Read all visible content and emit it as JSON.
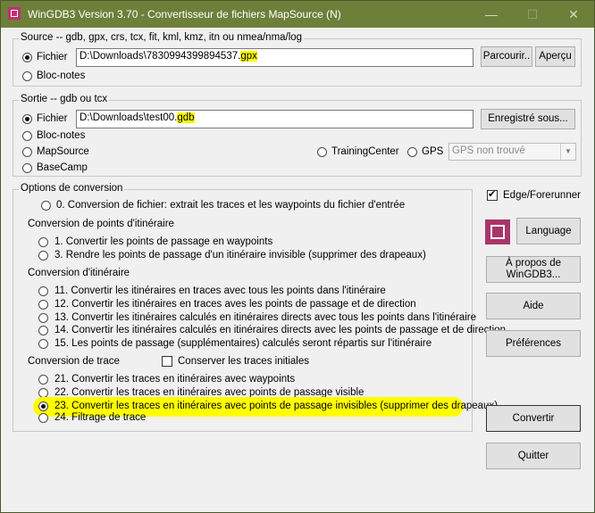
{
  "window": {
    "title": "WinGDB3 Version 3.70 - Convertisseur de fichiers MapSource (N)"
  },
  "source": {
    "legend": "Source -- gdb, gpx, crs, tcx, fit, kml, kmz, itn ou nmea/nma/log",
    "fichier_label": "Fichier",
    "path_prefix": "D:\\Downloads\\7830994399894537.",
    "path_ext": "gpx",
    "bloc_notes_label": "Bloc-notes",
    "browse_label": "Parcourir..",
    "preview_label": "Aperçu"
  },
  "sortie": {
    "legend": "Sortie -- gdb ou tcx",
    "fichier_label": "Fichier",
    "path_prefix": "D:\\Downloads\\test00.",
    "path_ext": "gdb",
    "save_label": "Enregistré sous...",
    "bloc_notes_label": "Bloc-notes",
    "mapsource_label": "MapSource",
    "basecamp_label": "BaseCamp",
    "trainingcenter_label": "TrainingCenter",
    "gps_label": "GPS",
    "gps_select": "GPS non trouvé"
  },
  "options": {
    "legend": "Options de conversion",
    "opt0": "0. Conversion de fichier: extrait les traces et les waypoints du fichier d'entrée",
    "section_points": "Conversion de points d'itinéraire",
    "opt1": "1. Convertir les points de passage en waypoints",
    "opt3": "3. Rendre les points de passage d'un itinéraire invisible (supprimer des drapeaux)",
    "section_itineraire": "Conversion d'itinéraire",
    "opt11": "11. Convertir les itinéraires en traces avec tous les points dans l'itinéraire",
    "opt12": "12. Convertir les itinéraires en traces aves les points de passage et de direction",
    "opt13": "13. Convertir les itinéraires calculés en itinéraires directs avec tous les points dans l'itinéraire",
    "opt14": "14. Convertir les itinéraires calculés en itinéraires directs avec les points de passage et de direction",
    "opt15": "15. Les points de passage (supplémentaires) calculés  seront répartis  sur l'itinéraire",
    "section_trace": "Conversion de trace",
    "keep_traces_label": "Conserver les traces initiales",
    "opt21": "21. Convertir les traces en itinéraires avec waypoints",
    "opt22": "22. Convertir les traces en itinéraires avec points de passage visible",
    "opt23": "23. Convertir les traces en itinéraires avec points de passage invisibles (supprimer des drapeaux)",
    "opt24": "24. Filtrage de trace"
  },
  "right": {
    "edge_label": "Edge/Forerunner",
    "language_label": "Language",
    "about_label": "À propos de WinGDB3...",
    "help_label": "Aide",
    "prefs_label": "Préférences",
    "convert_label": "Convertir",
    "quit_label": "Quitter"
  },
  "colors": {
    "titlebar": "#6e7f3a",
    "highlight": "#ffff00",
    "accent": "#a8366a"
  }
}
